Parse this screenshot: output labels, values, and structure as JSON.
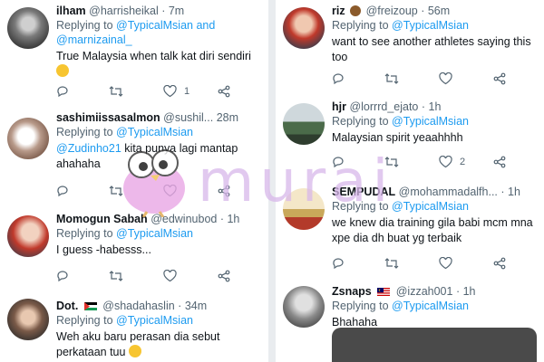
{
  "tweets_left": [
    {
      "name": "ilham",
      "handle": "@harrisheikal",
      "time": "7m",
      "reply_prefix": "Replying to",
      "mentions": "@TypicalMsian and @marnizainal_",
      "text": "True Malaysia when talk kat diri sendiri",
      "emoji": "laughing-face",
      "reply_count": "",
      "retweet_count": "",
      "like_count": "1"
    },
    {
      "name": "sashimiissasalmon",
      "handle": "@sushil...",
      "time": "28m",
      "reply_prefix": "Replying to",
      "mentions": "@TypicalMsian",
      "text_mention": "@Zudinho21",
      "text": "kita punya lagi mantap ahahaha",
      "like_count": ""
    },
    {
      "name": "Momogun Sabah",
      "handle": "@edwinubod",
      "time": "1h",
      "reply_prefix": "Replying to",
      "mentions": "@TypicalMsian",
      "text": "I guess -habesss...",
      "like_count": ""
    },
    {
      "name": "Dot.",
      "handle": "@shadahaslin",
      "time": "34m",
      "reply_prefix": "Replying to",
      "mentions": "@TypicalMsian",
      "text": "Weh aku baru perasan dia sebut perkataan tuu",
      "emoji": "crying-face"
    }
  ],
  "tweets_right": [
    {
      "name": "riz",
      "handle": "@freizoup",
      "time": "56m",
      "reply_prefix": "Replying to",
      "mentions": "@TypicalMsian",
      "text": "want to see another athletes saying this too",
      "like_count": ""
    },
    {
      "name": "hjr",
      "handle": "@lorrrd_ejato",
      "time": "1h",
      "reply_prefix": "Replying to",
      "mentions": "@TypicalMsian",
      "text": "Malaysian spirit yeaahhhh",
      "like_count": "2"
    },
    {
      "name": "SEMPUDAL",
      "handle": "@mohammadalfh...",
      "time": "1h",
      "reply_prefix": "Replying to",
      "mentions": "@TypicalMsian",
      "text": "we knew dia training gila babi mcm mna xpe dia dh buat yg terbaik",
      "like_count": ""
    },
    {
      "name": "Zsnaps",
      "handle": "@izzah001",
      "time": "1h",
      "reply_prefix": "Replying to",
      "mentions": "@TypicalMsian",
      "text": "Bhahaha"
    }
  ],
  "watermark": {
    "text": "murai"
  },
  "colors": {
    "link": "#1d9bf0",
    "secondary": "#536471",
    "primary": "#0f1419",
    "watermark": "#d8b7ea"
  }
}
